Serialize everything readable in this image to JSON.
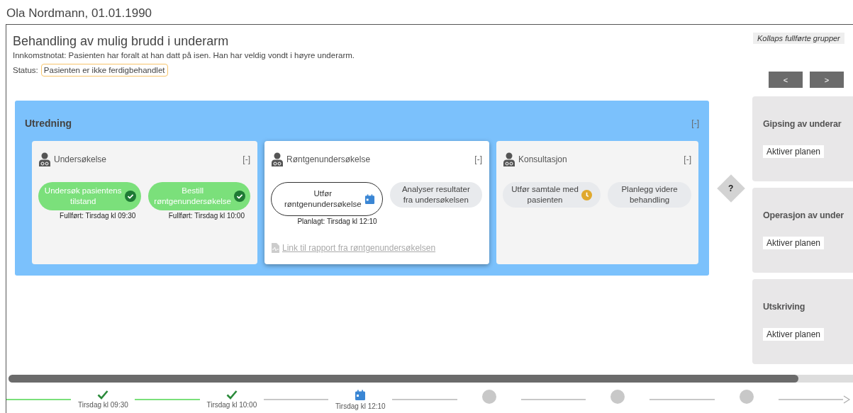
{
  "patient_header": "Ola Nordmann, 01.01.1990",
  "plan": {
    "title": "Behandling av mulig brudd i underarm",
    "note": "Innkomstnotat: Pasienten har foralt at han datt på isen. Han har veldig vondt i høyre underarm.",
    "status_label": "Status:",
    "status": "Pasienten er ikke ferdigbehandlet"
  },
  "collapse_button": "Kollaps fullførte grupper",
  "nav_buttons": [
    "<",
    ">"
  ],
  "group": {
    "title": "Utredning",
    "toggle": "[-]",
    "steps": [
      {
        "title": "Undersøkelse",
        "toggle": "[-]",
        "active": false,
        "tasks": [
          {
            "label": "Undersøk pasientens tilstand",
            "kind": "done",
            "note": "Fullført: Tirsdag kl 09:30"
          },
          {
            "label": "Bestill røntgenundersøkelse",
            "kind": "done",
            "note": "Fullført: Tirsdag kl 10:00"
          }
        ]
      },
      {
        "title": "Røntgenundersøkelse",
        "toggle": "[-]",
        "active": true,
        "tasks": [
          {
            "label": "Utfør røntgenundersøkelse",
            "kind": "planned",
            "note": "Planlagt: Tirsdag kl 12:10"
          },
          {
            "label": "Analyser resultater fra undersøkelsen",
            "kind": "open"
          }
        ],
        "link": "Link til rapport fra røntgenundersøkelsen"
      },
      {
        "title": "Konsultasjon",
        "toggle": "[-]",
        "active": false,
        "tasks": [
          {
            "label": "Utfør samtale med pasienten",
            "kind": "waiting"
          },
          {
            "label": "Planlegg videre behandling",
            "kind": "open"
          }
        ]
      }
    ]
  },
  "decision": "?",
  "alternatives": [
    {
      "title": "Gipsing av underar",
      "button": "Aktiver planen"
    },
    {
      "title": "Operasjon av under",
      "button": "Aktiver planen"
    },
    {
      "title": "Utskriving",
      "button": "Aktiver planen"
    }
  ],
  "timeline": [
    {
      "kind": "done",
      "label": "Tirsdag kl 09:30"
    },
    {
      "kind": "done",
      "label": "Tirsdag kl 10:00"
    },
    {
      "kind": "planned",
      "label": "Tirsdag kl 12:10"
    },
    {
      "kind": "pending"
    },
    {
      "kind": "pending"
    },
    {
      "kind": "pending"
    }
  ]
}
